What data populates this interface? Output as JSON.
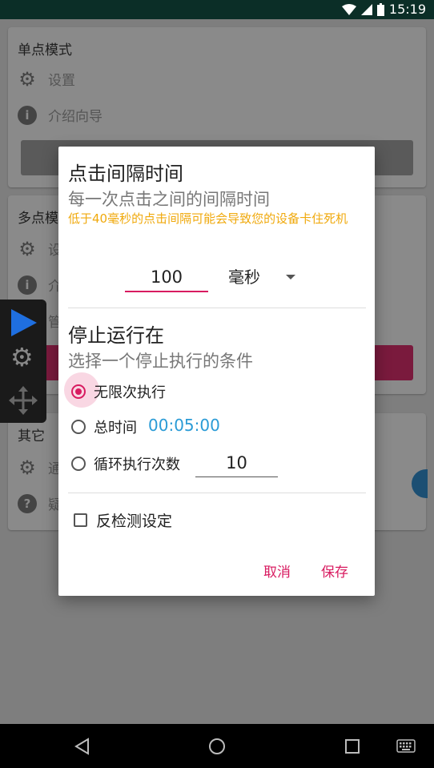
{
  "status_bar": {
    "time": "15:19"
  },
  "background": {
    "single_mode": {
      "title": "单点模式",
      "items": [
        "设置",
        "介绍向导"
      ]
    },
    "multi_mode": {
      "title": "多点模",
      "items": [
        "设",
        "介",
        "管"
      ]
    },
    "other": {
      "title": "其它",
      "items": [
        "通",
        "疑"
      ]
    }
  },
  "dialog": {
    "title": "点击间隔时间",
    "subtitle": "每一次点击之间的间隔时间",
    "warning": "低于40毫秒的点击间隔可能会导致您的设备卡住死机",
    "interval_value": "100",
    "interval_unit": "毫秒",
    "stop_title": "停止运行在",
    "stop_subtitle": "选择一个停止执行的条件",
    "options": [
      {
        "label": "无限次执行",
        "checked": true
      },
      {
        "label": "总时间",
        "value": "00:05:00",
        "checked": false
      },
      {
        "label": "循环执行次数",
        "value": "10",
        "checked": false
      }
    ],
    "anti_detect_label": "反检测设定",
    "cancel_label": "取消",
    "save_label": "保存"
  },
  "colors": {
    "accent": "#d81b60",
    "warning": "#f0a90c",
    "time": "#2a9bd6",
    "status_bar": "#0b2e27"
  }
}
